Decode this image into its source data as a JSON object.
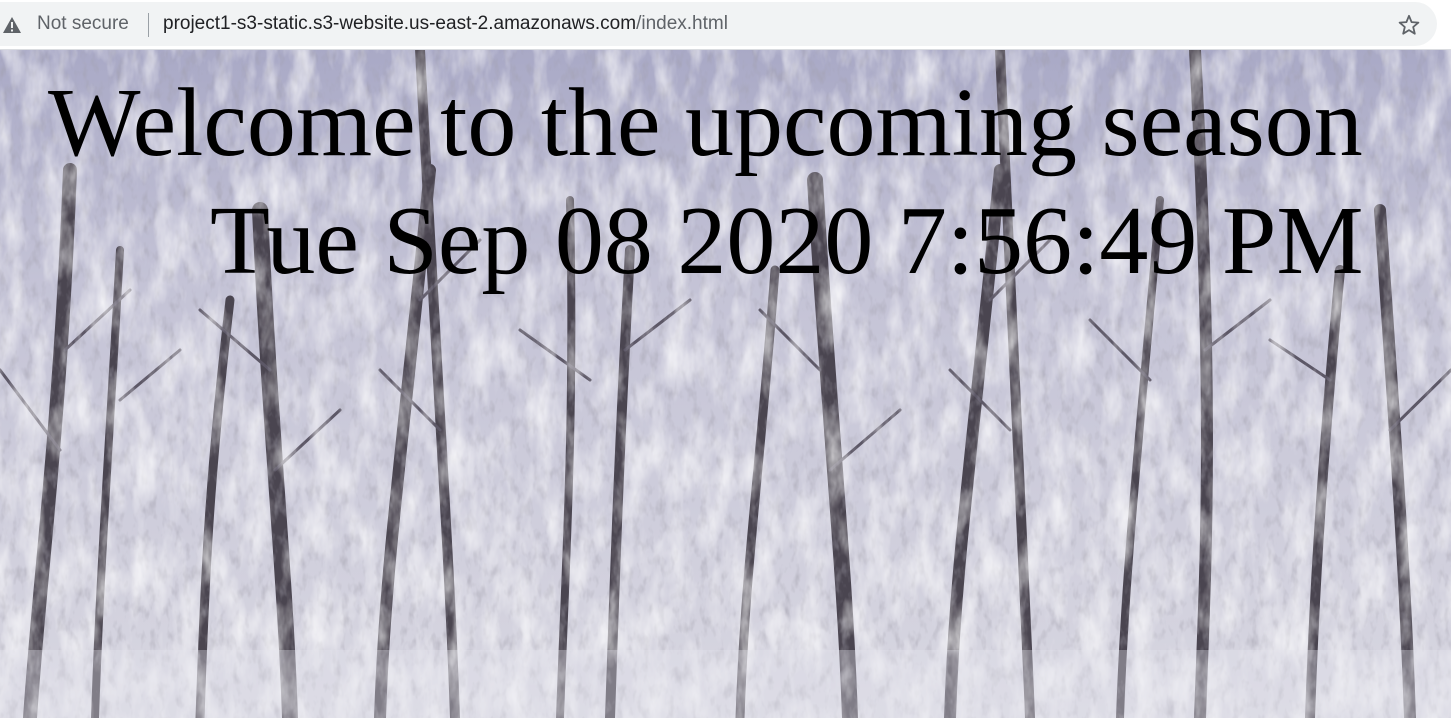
{
  "browser": {
    "security_label": "Not secure",
    "url_host": "project1-s3-static.s3-website.us-east-2.amazonaws.com",
    "url_path": "/index.html",
    "security_icon": "warning-triangle-icon",
    "bookmark_icon": "star-icon"
  },
  "page": {
    "heading": "Welcome to the upcoming season",
    "datetime": "Tue Sep 08 2020 7:56:49 PM",
    "background_image": "snowy winter forest with frost-covered trees",
    "text_color": "#000000"
  },
  "colors": {
    "omnibox_bg": "#f1f3f4",
    "secondary_text": "#5f6368",
    "primary_text": "#202124"
  }
}
